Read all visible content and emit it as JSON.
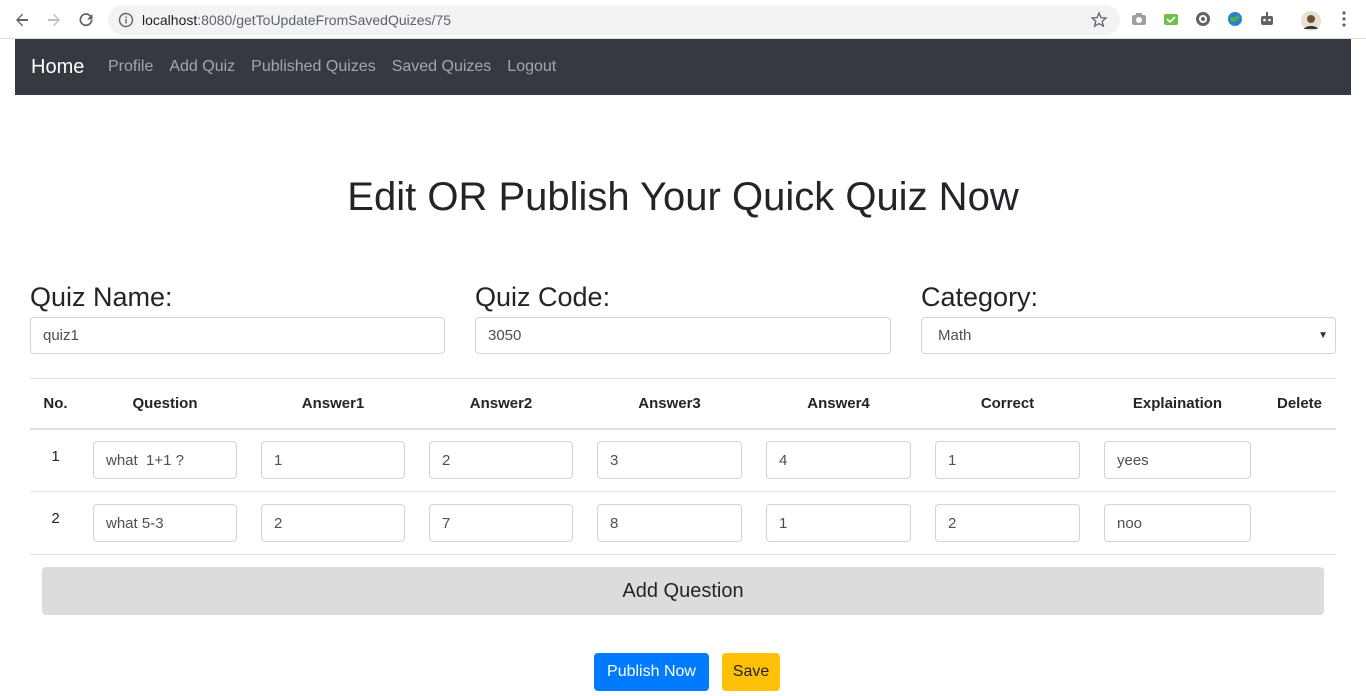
{
  "browser": {
    "url_host": "localhost",
    "url_rest": ":8080/getToUpdateFromSavedQuizes/75"
  },
  "navbar": {
    "brand": "Home",
    "links": [
      "Profile",
      "Add Quiz",
      "Published Quizes",
      "Saved Quizes",
      "Logout"
    ]
  },
  "page": {
    "title": "Edit OR Publish Your Quick Quiz Now"
  },
  "form": {
    "quiz_name_label": "Quiz Name:",
    "quiz_name_value": "quiz1",
    "quiz_code_label": "Quiz Code:",
    "quiz_code_value": "3050",
    "category_label": "Category:",
    "category_value": "Math"
  },
  "table": {
    "headers": [
      "No.",
      "Question",
      "Answer1",
      "Answer2",
      "Answer3",
      "Answer4",
      "Correct",
      "Explaination",
      "Delete"
    ],
    "rows": [
      {
        "no": "1",
        "question": "what  1+1 ?",
        "a1": "1",
        "a2": "2",
        "a3": "3",
        "a4": "4",
        "correct": "1",
        "explanation": "yees"
      },
      {
        "no": "2",
        "question": "what 5-3",
        "a1": "2",
        "a2": "7",
        "a3": "8",
        "a4": "1",
        "correct": "2",
        "explanation": "noo"
      }
    ]
  },
  "buttons": {
    "add_question": "Add Question",
    "publish": "Publish Now",
    "save": "Save"
  },
  "colors": {
    "navbar_bg": "#343a40",
    "primary": "#007bff",
    "warning": "#ffc107",
    "secondary_light": "#dcdcdc"
  }
}
